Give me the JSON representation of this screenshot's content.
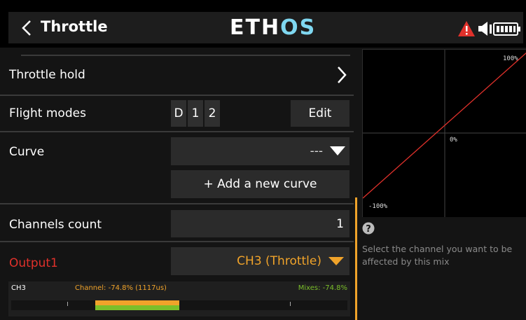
{
  "header": {
    "title": "Throttle",
    "logo_main": "ETH",
    "logo_accent": "OS"
  },
  "rows": {
    "throttle_hold": "Throttle hold",
    "flight_modes": "Flight modes",
    "flight_mode_items": [
      "D",
      "1",
      "2"
    ],
    "edit_label": "Edit",
    "curve": "Curve",
    "curve_value": "---",
    "add_curve_label": "+ Add a new curve",
    "channels_count": "Channels count",
    "channels_count_value": "1",
    "output_label": "Output1",
    "output_value": "CH3 (Throttle)"
  },
  "monitor": {
    "channel_name": "CH3",
    "channel_text": "Channel: -74.8% (1117us)",
    "mixes_text": "Mixes: -74.8%"
  },
  "graph": {
    "top_label": "100%",
    "mid_label": "0%",
    "bottom_label": "-100%"
  },
  "help": {
    "text": "Select the channel you want to be affected by this mix"
  },
  "colors": {
    "accent_orange": "#f0a32a",
    "output_red": "#e0312b",
    "mixes_green": "#7bbf2a",
    "curve_red": "#e0312b",
    "warning_red": "#e0312b"
  }
}
